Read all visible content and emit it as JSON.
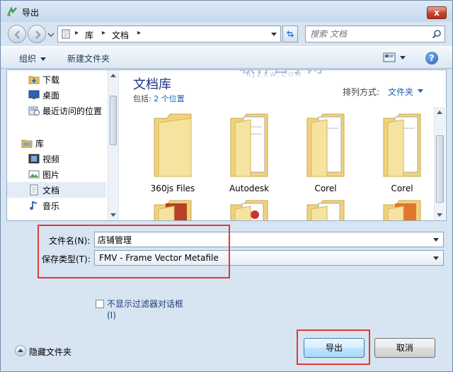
{
  "window": {
    "title": "导出",
    "close_label": "x"
  },
  "navbar": {
    "breadcrumbs": [
      "库",
      "文档"
    ],
    "search_placeholder": "搜索 文档"
  },
  "toolbar": {
    "organize": "组织",
    "new_folder": "新建文件夹",
    "help": "?"
  },
  "watermark": {
    "main": "软件自学网",
    "sub": "RJZXW.COM"
  },
  "nav_pane": {
    "items": [
      {
        "label": "下载",
        "icon": "download-folder-icon"
      },
      {
        "label": "桌面",
        "icon": "desktop-icon"
      },
      {
        "label": "最近访问的位置",
        "icon": "recent-places-icon"
      },
      {
        "label": "库",
        "icon": "library-icon"
      },
      {
        "label": "视频",
        "icon": "video-icon"
      },
      {
        "label": "图片",
        "icon": "pictures-icon"
      },
      {
        "label": "文档",
        "icon": "documents-icon",
        "selected": true
      },
      {
        "label": "音乐",
        "icon": "music-icon"
      }
    ]
  },
  "library": {
    "title": "文档库",
    "includes_prefix": "包括:",
    "includes_link": "2 个位置",
    "arrange_label": "排列方式:",
    "arrange_value": "文件夹"
  },
  "folders": [
    "360js Files",
    "Autodesk",
    "Corel",
    "Corel"
  ],
  "form": {
    "filename_label": "文件名(N):",
    "filename_value": "店铺管理",
    "filetype_label": "保存类型(T):",
    "filetype_value": "FMV - Frame Vector Metafile",
    "checkbox_label": "不显示过滤器对话框",
    "checkbox_key": "(I)",
    "checkbox_checked": false
  },
  "footer": {
    "hide_folders": "隐藏文件夹",
    "export_button": "导出",
    "cancel_button": "取消"
  },
  "colors": {
    "highlight": "#e03a3a",
    "link": "#1f5fb8"
  }
}
